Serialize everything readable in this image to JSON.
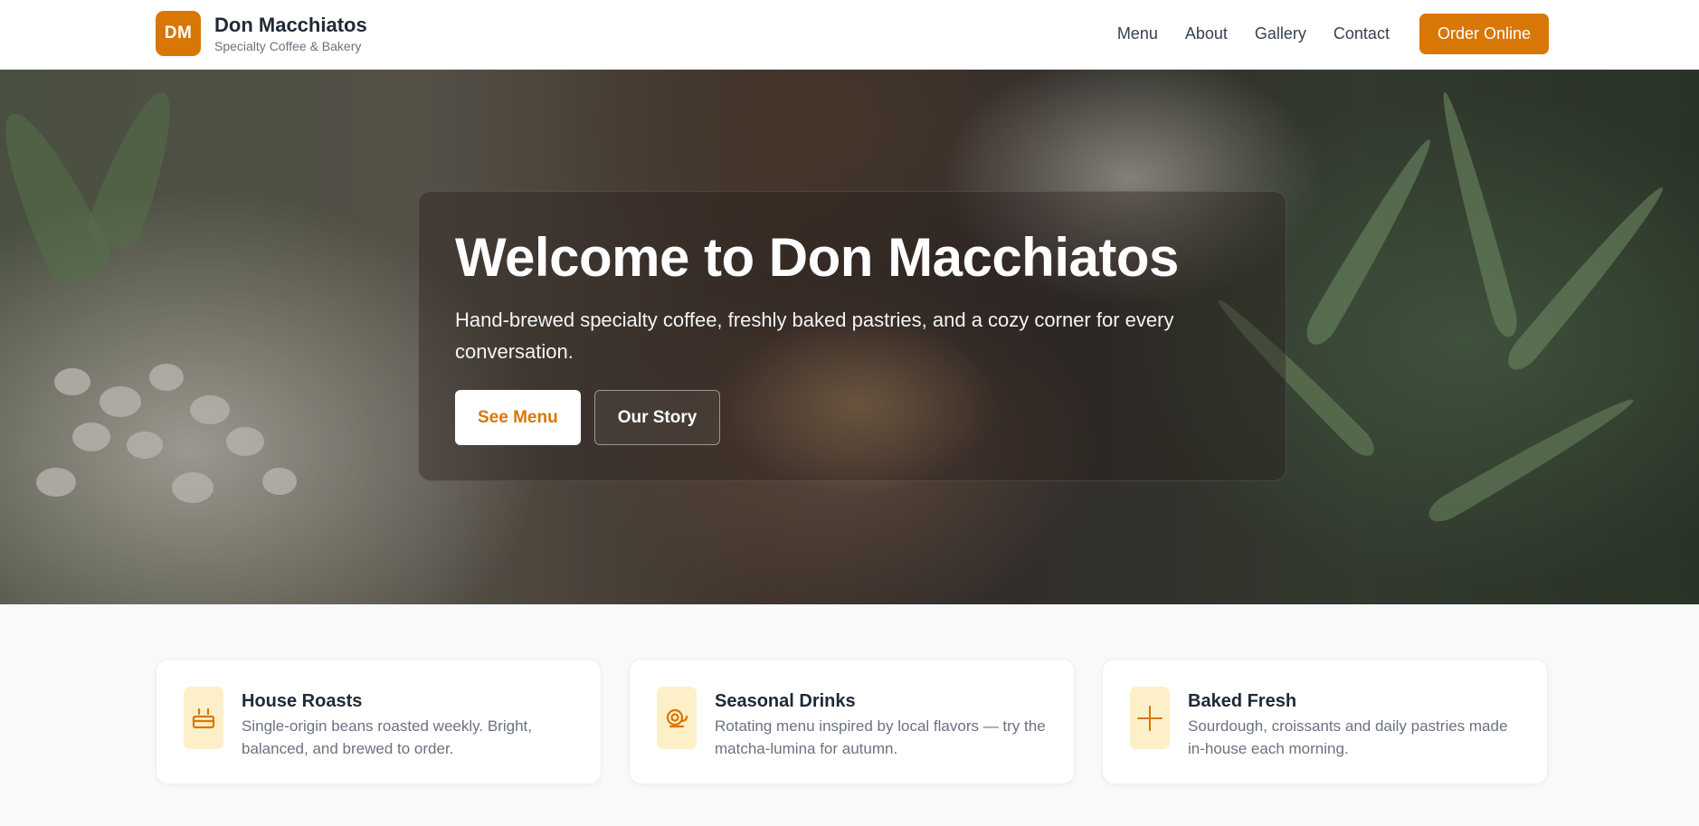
{
  "header": {
    "logo_initials": "DM",
    "brand_name": "Don Macchiatos",
    "brand_tagline": "Specialty Coffee & Bakery",
    "nav": [
      "Menu",
      "About",
      "Gallery",
      "Contact"
    ],
    "cta": "Order Online"
  },
  "hero": {
    "title": "Welcome to Don Macchiatos",
    "subtitle": "Hand-brewed specialty coffee, freshly baked pastries, and a cozy corner for every conversation.",
    "primary_button": "See Menu",
    "secondary_button": "Our Story"
  },
  "features": [
    {
      "icon": "coffee-cup-icon",
      "title": "House Roasts",
      "description": "Single-origin beans roasted weekly. Bright, balanced, and brewed to order."
    },
    {
      "icon": "teapot-icon",
      "title": "Seasonal Drinks",
      "description": "Rotating menu inspired by local flavors — try the matcha-lumina for autumn."
    },
    {
      "icon": "plus-icon",
      "title": "Baked Fresh",
      "description": "Sourdough, croissants and daily pastries made in-house each morning."
    }
  ],
  "colors": {
    "accent": "#d97706",
    "icon_bg": "#fdf0c8",
    "page_bg": "#f8f9fb"
  }
}
